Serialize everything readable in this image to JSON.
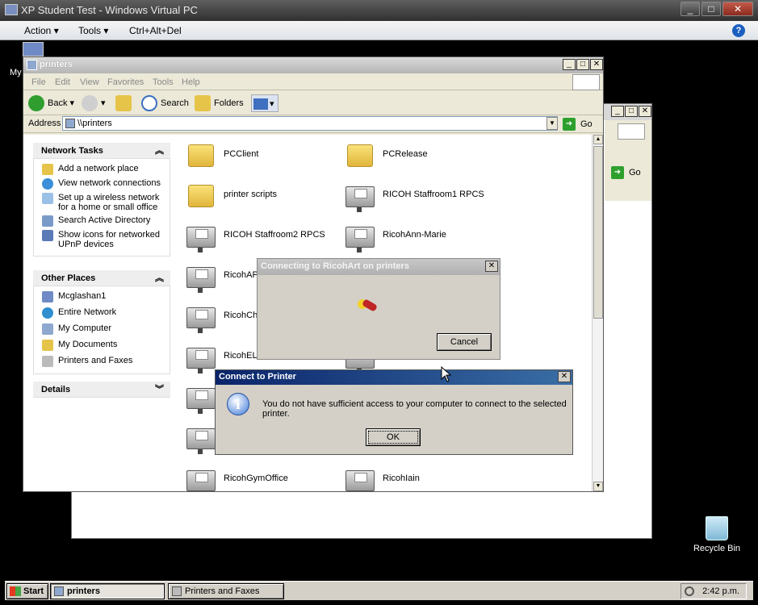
{
  "host": {
    "title": "XP Student Test - Windows Virtual PC",
    "menu": {
      "action": "Action",
      "tools": "Tools",
      "ctrl_alt_del": "Ctrl+Alt+Del",
      "help_icon": "?"
    }
  },
  "desktop": {
    "partial_icon_label": "My",
    "recycle_bin_label": "Recycle Bin"
  },
  "explorer": {
    "title": "printers",
    "menu": [
      "File",
      "Edit",
      "View",
      "Favorites",
      "Tools",
      "Help"
    ],
    "toolbar": {
      "back": "Back",
      "search": "Search",
      "folders": "Folders"
    },
    "address": {
      "label": "Address",
      "value": "\\\\printers",
      "go": "Go"
    },
    "network_tasks": {
      "header": "Network Tasks",
      "items": [
        {
          "label": "Add a network place",
          "icon": "add-network-place-icon"
        },
        {
          "label": "View network connections",
          "icon": "network-connections-icon"
        },
        {
          "label": "Set up a wireless network for a home or small office",
          "icon": "wireless-icon"
        },
        {
          "label": "Search Active Directory",
          "icon": "search-directory-icon"
        },
        {
          "label": "Show icons for networked UPnP devices",
          "icon": "upnp-icon"
        }
      ]
    },
    "other_places": {
      "header": "Other Places",
      "items": [
        {
          "label": "Mcglashan1",
          "icon": "computer-network-icon"
        },
        {
          "label": "Entire Network",
          "icon": "globe-icon"
        },
        {
          "label": "My Computer",
          "icon": "my-computer-icon"
        },
        {
          "label": "My Documents",
          "icon": "my-documents-icon"
        },
        {
          "label": "Printers and Faxes",
          "icon": "printer-icon"
        }
      ]
    },
    "details": {
      "header": "Details"
    },
    "files": [
      {
        "name": "PCClient",
        "type": "folder"
      },
      {
        "name": "PCRelease",
        "type": "folder"
      },
      {
        "name": "printer scripts",
        "type": "folder"
      },
      {
        "name": "RICOH Staffroom1 RPCS",
        "type": "printer"
      },
      {
        "name": "RICOH Staffroom2 RPCS",
        "type": "printer"
      },
      {
        "name": "RicohAnn-Marie",
        "type": "printer"
      },
      {
        "name": "RicohAPOf",
        "type": "printer"
      },
      {
        "name": "",
        "type": "printer"
      },
      {
        "name": "RicohChris",
        "type": "printer"
      },
      {
        "name": "",
        "type": "printer"
      },
      {
        "name": "RicohELCB",
        "type": "printer"
      },
      {
        "name": "",
        "type": "printer"
      },
      {
        "name": "",
        "type": "printer"
      },
      {
        "name": "",
        "type": "printer"
      },
      {
        "name": "",
        "type": "printer"
      },
      {
        "name": "",
        "type": "printer"
      },
      {
        "name": "RicohGymOffice",
        "type": "printer"
      },
      {
        "name": "RicohIain",
        "type": "printer"
      }
    ]
  },
  "connecting_dialog": {
    "title": "Connecting to RicohArt on printers",
    "cancel": "Cancel"
  },
  "connect_dialog": {
    "title": "Connect to Printer",
    "message": "You do not have sufficient access to your computer to connect to the selected printer.",
    "ok": "OK"
  },
  "taskbar": {
    "start": "Start",
    "tasks": [
      {
        "label": "printers",
        "active": true
      },
      {
        "label": "Printers and Faxes",
        "active": false
      }
    ],
    "clock": "2:42 p.m."
  },
  "colors": {
    "xp_title_active": "#0a246a",
    "xp_face": "#d4d0c8",
    "explorer_face": "#ece9d8"
  }
}
